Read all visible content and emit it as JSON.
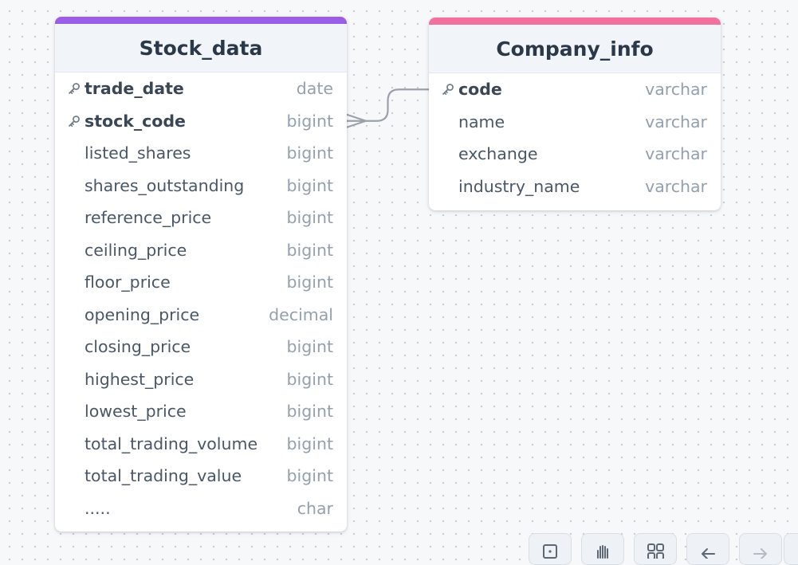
{
  "tables": [
    {
      "id": "stock_data",
      "name": "Stock_data",
      "accent_color": "#9b5de5",
      "columns": [
        {
          "name": "trade_date",
          "type": "date",
          "pk": true
        },
        {
          "name": "stock_code",
          "type": "bigint",
          "pk": true
        },
        {
          "name": "listed_shares",
          "type": "bigint",
          "pk": false
        },
        {
          "name": "shares_outstanding",
          "type": "bigint",
          "pk": false
        },
        {
          "name": "reference_price",
          "type": "bigint",
          "pk": false
        },
        {
          "name": "ceiling_price",
          "type": "bigint",
          "pk": false
        },
        {
          "name": "floor_price",
          "type": "bigint",
          "pk": false
        },
        {
          "name": "opening_price",
          "type": "decimal",
          "pk": false
        },
        {
          "name": "closing_price",
          "type": "bigint",
          "pk": false
        },
        {
          "name": "highest_price",
          "type": "bigint",
          "pk": false
        },
        {
          "name": "lowest_price",
          "type": "bigint",
          "pk": false
        },
        {
          "name": "total_trading_volume",
          "type": "bigint",
          "pk": false
        },
        {
          "name": "total_trading_value",
          "type": "bigint",
          "pk": false
        },
        {
          "name": ".....",
          "type": "char",
          "pk": false
        }
      ]
    },
    {
      "id": "company_info",
      "name": "Company_info",
      "accent_color": "#f2709c",
      "columns": [
        {
          "name": "code",
          "type": "varchar",
          "pk": true
        },
        {
          "name": "name",
          "type": "varchar",
          "pk": false
        },
        {
          "name": "exchange",
          "type": "varchar",
          "pk": false
        },
        {
          "name": "industry_name",
          "type": "varchar",
          "pk": false
        }
      ]
    }
  ],
  "relations": [
    {
      "from_table": "stock_data",
      "from_column": "stock_code",
      "to_table": "company_info",
      "to_column": "code",
      "cardinality": "many-to-one"
    }
  ],
  "colors": {
    "relation_line": "#9aa1aa",
    "key_icon": "#6b7785"
  },
  "toolbar": {
    "buttons": [
      {
        "id": "fit-view",
        "icon": "frame-icon"
      },
      {
        "id": "pan",
        "icon": "hand-icon"
      },
      {
        "id": "arrange",
        "icon": "grid-icon"
      },
      {
        "id": "undo",
        "icon": "undo-arrow-icon"
      },
      {
        "id": "redo",
        "icon": "redo-arrow-icon"
      }
    ]
  }
}
